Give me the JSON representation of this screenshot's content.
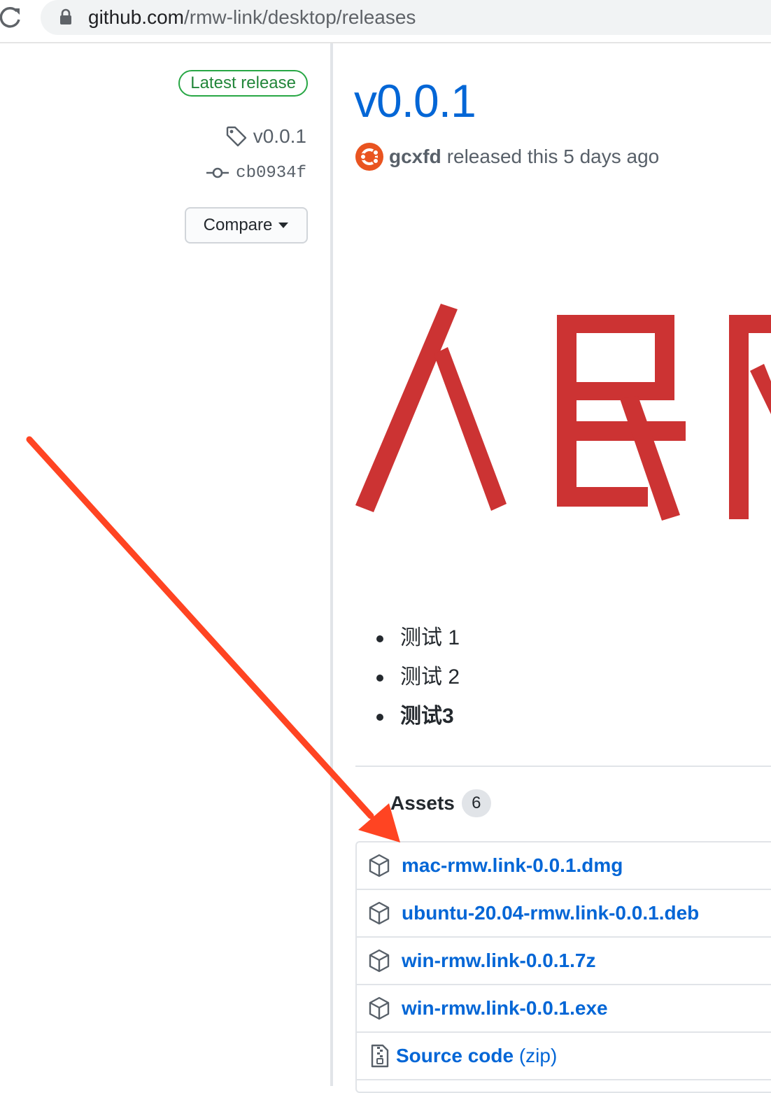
{
  "browser": {
    "url_host": "github.com",
    "url_path": "/rmw-link/desktop/releases"
  },
  "sidebar": {
    "latest_badge": "Latest release",
    "tag": "v0.0.1",
    "commit": "cb0934f",
    "compare_label": "Compare"
  },
  "release": {
    "title": "v0.0.1",
    "author": "gcxfd",
    "meta": "released this 5 days ago",
    "image_text": "人民网",
    "notes": [
      "测试 1",
      "测试 2",
      "测试3"
    ]
  },
  "assets": {
    "label": "Assets",
    "count": "6",
    "items": [
      {
        "name": "mac-rmw.link-0.0.1.dmg",
        "icon": "package-icon"
      },
      {
        "name": "ubuntu-20.04-rmw.link-0.0.1.deb",
        "icon": "package-icon"
      },
      {
        "name": "win-rmw.link-0.0.1.7z",
        "icon": "package-icon"
      },
      {
        "name": "win-rmw.link-0.0.1.exe",
        "icon": "package-icon"
      },
      {
        "name": "Source code",
        "suffix": "(zip)",
        "icon": "file-zip-icon"
      }
    ]
  },
  "colors": {
    "link": "#0366d6",
    "badge_green": "#28a745",
    "banner_red": "#cc3333",
    "annotation_arrow": "#ff4422"
  }
}
